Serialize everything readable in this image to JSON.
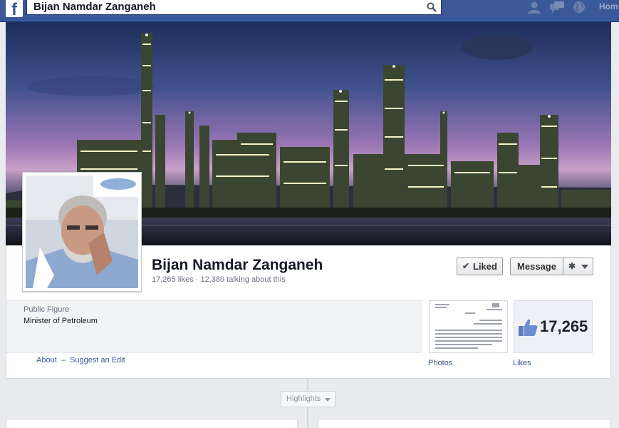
{
  "topbar": {
    "logo_letter": "f",
    "search_value": "Bijan Namdar Zanganeh",
    "home_label": "Hom"
  },
  "profile": {
    "name": "Bijan Namdar Zanganeh",
    "stats": "17,265 likes · 12,380 talking about this"
  },
  "actions": {
    "liked_label": "Liked",
    "message_label": "Message"
  },
  "about": {
    "category": "Public Figure",
    "description": "Minister of Petroleum",
    "about_link": "About",
    "separator": "–",
    "suggest_link": "Suggest an Edit"
  },
  "apps": {
    "photos_label": "Photos",
    "likes_count": "17,265",
    "likes_label": "Likes"
  },
  "timeline": {
    "highlights_label": "Highlights"
  },
  "colors": {
    "brand_blue": "#3b5998",
    "page_bg": "#e9ebee"
  }
}
